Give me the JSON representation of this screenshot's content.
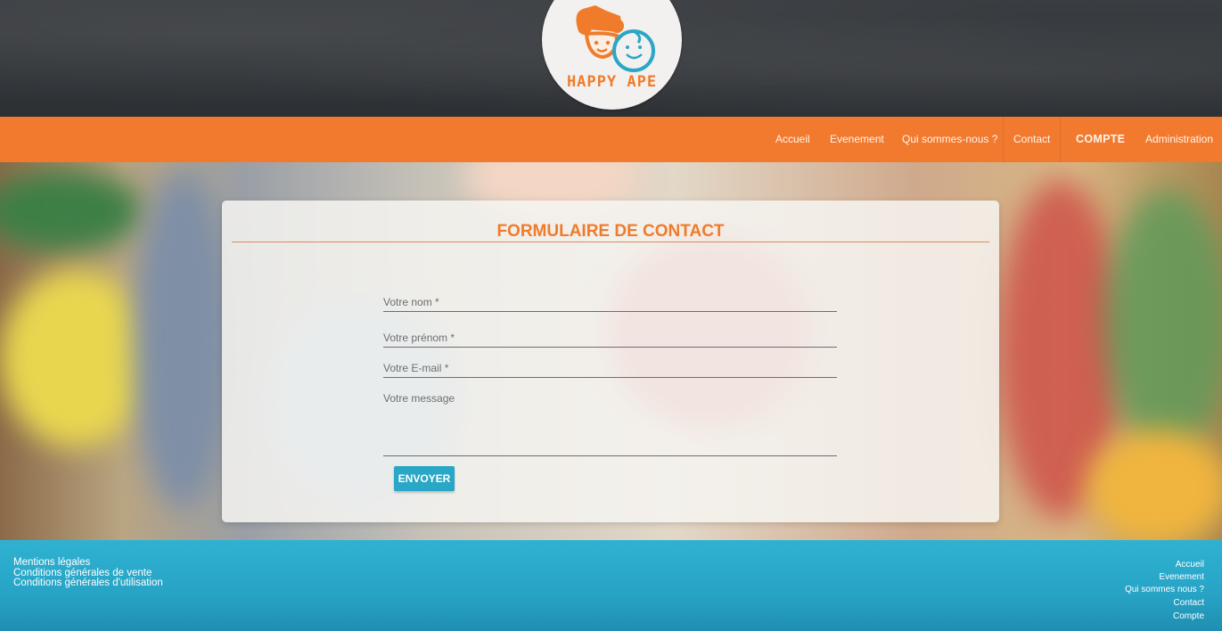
{
  "header": {
    "logo_text": "HAPPY APE",
    "colors": {
      "orange": "#f27a2e",
      "blue": "#2aa6c6",
      "chalkboard": "#2c2f33"
    }
  },
  "nav": {
    "items": [
      "Accueil",
      "Evenement",
      "Qui sommes-nous ?",
      "Contact",
      "COMPTE",
      "Administration"
    ]
  },
  "form": {
    "title": "FORMULAIRE DE CONTACT",
    "name_placeholder": "Votre nom *",
    "firstname_placeholder": "Votre prénom *",
    "email_placeholder": "Votre E-mail *",
    "message_placeholder": "Votre message",
    "submit_label": "ENVOYER"
  },
  "footer": {
    "left_links": [
      "Mentions légales",
      "Conditions générales de vente",
      "Conditions générales d'utilisation"
    ],
    "right_links": [
      "Accueil",
      "Evenement",
      "Qui sommes nous ?",
      "Contact",
      "Compte"
    ]
  }
}
